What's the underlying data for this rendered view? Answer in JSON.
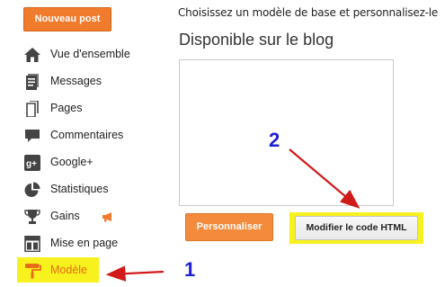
{
  "toolbar": {
    "new_post_label": "Nouveau post"
  },
  "sidebar": {
    "items": [
      {
        "label": "Vue d'ensemble",
        "icon": "home-icon"
      },
      {
        "label": "Messages",
        "icon": "messages-icon"
      },
      {
        "label": "Pages",
        "icon": "pages-icon"
      },
      {
        "label": "Commentaires",
        "icon": "comment-icon"
      },
      {
        "label": "Google+",
        "icon": "google-plus-icon"
      },
      {
        "label": "Statistiques",
        "icon": "pie-chart-icon"
      },
      {
        "label": "Gains",
        "icon": "trophy-icon",
        "badge_icon": "megaphone-icon"
      },
      {
        "label": "Mise en page",
        "icon": "layout-icon"
      },
      {
        "label": "Modèle",
        "icon": "paint-roller-icon",
        "active": true
      }
    ]
  },
  "main": {
    "intro_text": "Choisissez un modèle de base et personnalisez-le",
    "section_title": "Disponible sur le blog",
    "customize_label": "Personnaliser",
    "edit_html_label": "Modifier le code HTML"
  },
  "annotations": {
    "step1": "1",
    "step2": "2"
  },
  "colors": {
    "accent_orange": "#f07b2c",
    "highlight_yellow": "#f7f21e",
    "arrow_red": "#d11a1a",
    "step_blue": "#1f1fd1",
    "active_label": "#e86b17"
  }
}
